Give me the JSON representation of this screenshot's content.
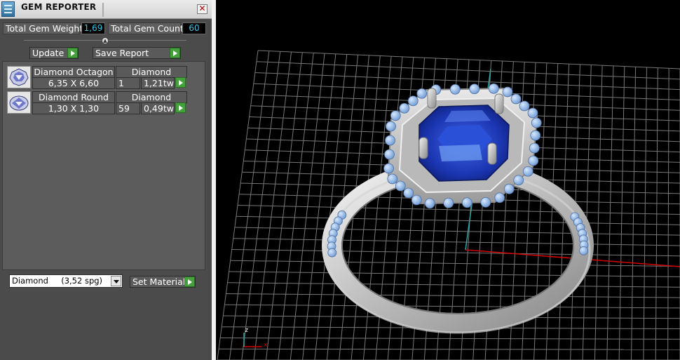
{
  "window": {
    "title": "GEM REPORTER"
  },
  "stats": {
    "total_weight_label": "Total Gem Weight",
    "total_weight_value": "1,69",
    "total_count_label": "Total Gem Count",
    "total_count_value": "60"
  },
  "toolbar": {
    "update_label": "Update",
    "save_report_label": "Save Report"
  },
  "gems": [
    {
      "name": "Diamond Octagon",
      "material": "Diamond",
      "size": "6,35 X 6,60",
      "count": "1",
      "weight": "1,21tw",
      "thumb_icon": "octagon-gem-icon"
    },
    {
      "name": "Diamond Round",
      "material": "Diamond",
      "size": "1,30 X 1,30",
      "count": "59",
      "weight": "0,49tw",
      "thumb_icon": "round-gem-icon"
    }
  ],
  "material_select": {
    "selected": "Diamond     (3,52 spg)"
  },
  "set_material_label": "Set Material",
  "viewport": {
    "axis_x_label": "x",
    "axis_z_label": "z"
  },
  "colors": {
    "accent_value": "#3ec4e7",
    "arrow_green": "#44a13c",
    "grid": "#9a9a9a",
    "stone_blue": "#1f3fbf",
    "metal": "#d8d8d8",
    "axis_x": "#d40000",
    "axis_y": "#2fa5a5"
  }
}
